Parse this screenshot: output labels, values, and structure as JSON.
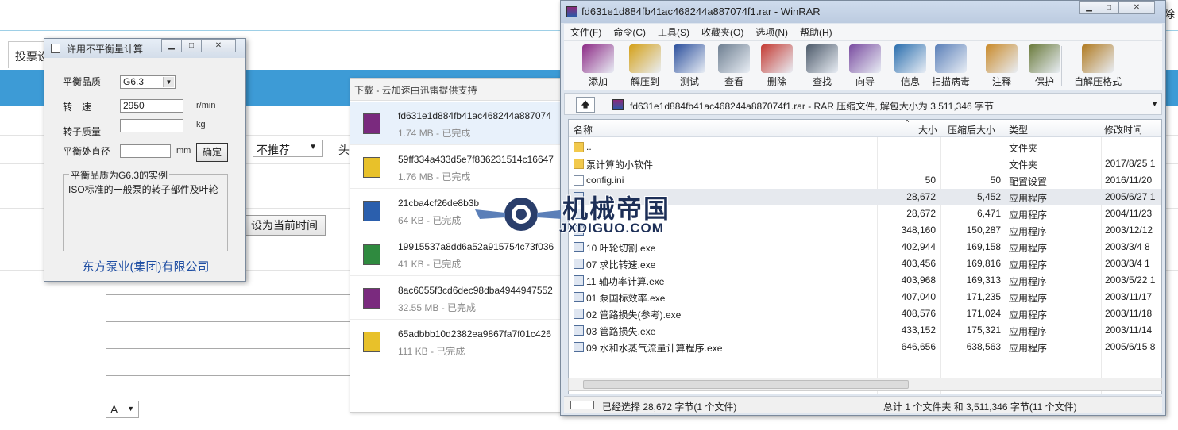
{
  "background_page": {
    "tab_label": "投票设",
    "select_value": "不推荐",
    "side_label": "头",
    "set_time_button": "设为当前时间",
    "small_select_value": "A",
    "corner_text": "除"
  },
  "calc_dialog": {
    "title": "许用不平衡量计算",
    "labels": {
      "grade": "平衡品质",
      "speed": "转　速",
      "mass": "转子质量",
      "diameter": "平衡处直径"
    },
    "grade_value": "G6.3",
    "speed_value": "2950",
    "mass_value": "",
    "diameter_value": "",
    "speed_unit": "r/min",
    "mass_unit": "kg",
    "diameter_unit": "mm",
    "confirm_button": "确定",
    "group_title": "平衡品质为G6.3的实例",
    "group_text": "ISO标准的一般泵的转子部件及叶轮",
    "company": "东方泵业(集团)有限公司"
  },
  "download_panel": {
    "title": "下载 - 云加速由迅雷提供支持",
    "items": [
      {
        "name": "fd631e1d884fb41ac468244a887074",
        "size": "1.74 MB",
        "status": "- 已完成",
        "type": "rar"
      },
      {
        "name": "59ff334a433d5e7f836231514c16647",
        "size": "1.76 MB",
        "status": "- 已完成",
        "type": "pkg"
      },
      {
        "name": "21cba4cf26de8b3b",
        "size": "64 KB",
        "status": "- 已完成",
        "type": "doc"
      },
      {
        "name": "19915537a8dd6a52a915754c73f036",
        "size": "41 KB",
        "status": "- 已完成",
        "type": "xls"
      },
      {
        "name": "8ac6055f3cd6dec98dba4944947552",
        "size": "32.55 MB",
        "status": "- 已完成",
        "type": "rar"
      },
      {
        "name": "65adbbb10d2382ea9867fa7f01c426",
        "size": "111 KB",
        "status": "- 已完成",
        "type": "pkg"
      }
    ]
  },
  "winrar": {
    "title": "fd631e1d884fb41ac468244a887074f1.rar - WinRAR",
    "menu": [
      "文件(F)",
      "命令(C)",
      "工具(S)",
      "收藏夹(O)",
      "选项(N)",
      "帮助(H)"
    ],
    "toolbar": [
      "添加",
      "解压到",
      "测试",
      "查看",
      "删除",
      "查找",
      "向导",
      "信息",
      "扫描病毒",
      "注释",
      "保护",
      "自解压格式"
    ],
    "path_text": "fd631e1d884fb41ac468244a887074f1.rar - RAR 压缩文件, 解包大小为 3,511,346 字节",
    "columns": [
      "名称",
      "大小",
      "压缩后大小",
      "类型",
      "修改时间"
    ],
    "rows": [
      {
        "name": "..",
        "size": "",
        "packed": "",
        "type": "文件夹",
        "modified": "",
        "icon": "folder"
      },
      {
        "name": "泵计算的小软件",
        "size": "",
        "packed": "",
        "type": "文件夹",
        "modified": "2017/8/25 1",
        "icon": "folder"
      },
      {
        "name": "config.ini",
        "size": "50",
        "packed": "50",
        "type": "配置设置",
        "modified": "2016/11/20",
        "icon": "ini"
      },
      {
        "name": "",
        "size": "28,672",
        "packed": "5,452",
        "type": "应用程序",
        "modified": "2005/6/27 1",
        "icon": "exe",
        "selected": true
      },
      {
        "name": "",
        "size": "28,672",
        "packed": "6,471",
        "type": "应用程序",
        "modified": "2004/11/23",
        "icon": "exe"
      },
      {
        "name": "",
        "size": "348,160",
        "packed": "150,287",
        "type": "应用程序",
        "modified": "2003/12/12",
        "icon": "exe"
      },
      {
        "name": "10  叶轮切割.exe",
        "size": "402,944",
        "packed": "169,158",
        "type": "应用程序",
        "modified": "2003/3/4 8",
        "icon": "exe"
      },
      {
        "name": "07  求比转速.exe",
        "size": "403,456",
        "packed": "169,816",
        "type": "应用程序",
        "modified": "2003/3/4 1",
        "icon": "exe"
      },
      {
        "name": "11  轴功率计算.exe",
        "size": "403,968",
        "packed": "169,313",
        "type": "应用程序",
        "modified": "2003/5/22 1",
        "icon": "exe"
      },
      {
        "name": "01  泵国标效率.exe",
        "size": "407,040",
        "packed": "171,235",
        "type": "应用程序",
        "modified": "2003/11/17",
        "icon": "exe"
      },
      {
        "name": "02  管路损失(参考).exe",
        "size": "408,576",
        "packed": "171,024",
        "type": "应用程序",
        "modified": "2003/11/18",
        "icon": "exe"
      },
      {
        "name": "03  管路损失.exe",
        "size": "433,152",
        "packed": "175,321",
        "type": "应用程序",
        "modified": "2003/11/14",
        "icon": "exe"
      },
      {
        "name": "09  水和水蒸气流量计算程序.exe",
        "size": "646,656",
        "packed": "638,563",
        "type": "应用程序",
        "modified": "2005/6/15 8",
        "icon": "exe"
      }
    ],
    "status_left": "已经选择 28,672 字节(1 个文件)",
    "status_right": "总计 1 个文件夹 和 3,511,346 字节(11 个文件)"
  },
  "watermark": {
    "cn": "机械帝国",
    "en": "JXDIGUO.COM"
  }
}
